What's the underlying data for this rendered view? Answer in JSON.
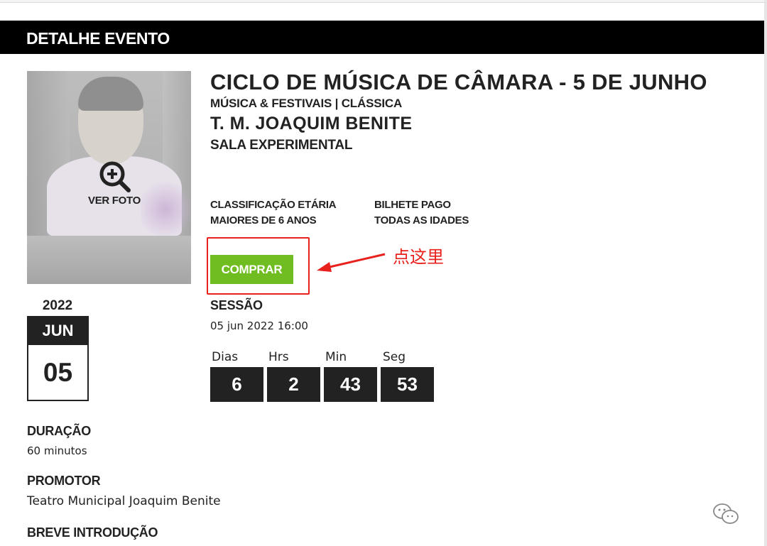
{
  "header": {
    "title": "DETALHE EVENTO"
  },
  "photo": {
    "label": "VER FOTO",
    "icon": "zoom-in-icon"
  },
  "date": {
    "year": "2022",
    "month": "JUN",
    "day": "05"
  },
  "event": {
    "title": "CICLO DE MÚSICA DE CÂMARA - 5 DE JUNHO",
    "category": "MÚSICA & FESTIVAIS | CLÁSSICA",
    "venue": "T. M. JOAQUIM BENITE",
    "room": "SALA EXPERIMENTAL"
  },
  "info": {
    "age_label": "CLASSIFICAÇÃO ETÁRIA",
    "age_value": "MAIORES DE 6 ANOS",
    "ticket_label": "BILHETE PAGO",
    "ticket_value": "TODAS AS IDADES"
  },
  "buy_button": {
    "label": "COMPRAR",
    "color": "#6fbd20"
  },
  "annotation": {
    "text": "点这里",
    "color": "#e8211c"
  },
  "session": {
    "label": "SESSÃO",
    "datetime": "05 jun 2022 16:00"
  },
  "countdown": [
    {
      "label": "Dias",
      "value": "6"
    },
    {
      "label": "Hrs",
      "value": "2"
    },
    {
      "label": "Min",
      "value": "43"
    },
    {
      "label": "Seg",
      "value": "53"
    }
  ],
  "details": {
    "duration_label": "DURAÇÃO",
    "duration_value": "60 minutos",
    "promoter_label": "PROMOTOR",
    "promoter_value": "Teatro Municipal Joaquim Benite",
    "intro_label": "BREVE INTRODUÇÃO"
  },
  "watermark": {
    "icon": "wechat-icon"
  }
}
